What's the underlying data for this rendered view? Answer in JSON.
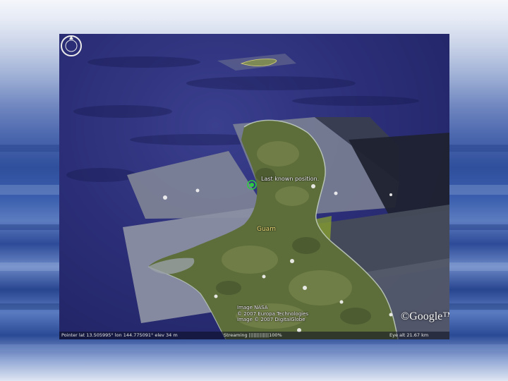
{
  "map": {
    "placemark_label": "Last known position.",
    "island_label": "Guam",
    "credits": [
      "Image NASA",
      "© 2007 Europa Technologies",
      "Image © 2007 DigitalGlobe"
    ],
    "logo": "©Google™"
  },
  "statusbar": {
    "pointer": "Pointer  lat   13.505995°  lon  144.775091° elev    34 m",
    "streaming": "Streaming  |||||||||||||100%",
    "eye_alt": "Eye alt    21.67 km"
  },
  "icons": {
    "placemark": "placemark-icon",
    "compass": "compass-icon"
  },
  "colors": {
    "ocean": "#2c2f78",
    "land": "#5d6e3a",
    "island_label": "#f3e07a",
    "placemark": "#2ecc40"
  }
}
